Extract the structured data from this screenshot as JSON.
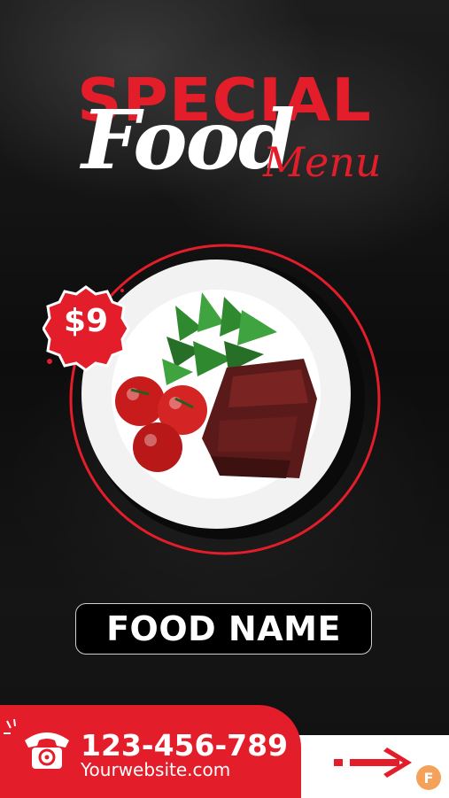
{
  "header": {
    "title_special": "SPECIAL",
    "title_food": "Food",
    "title_menu": "Menu"
  },
  "price": {
    "label": "$9"
  },
  "food": {
    "name": "FOOD NAME"
  },
  "contact": {
    "phone": "123-456-789",
    "website": "Yourwebsite.com"
  },
  "brand": {
    "logo_letter": "F"
  },
  "colors": {
    "accent": "#e31d2a",
    "background": "#0b0b0b",
    "text": "#ffffff",
    "logo": "#f4a259"
  },
  "icons": [
    "phone-icon",
    "arrow-right-icon",
    "brand-logo-icon"
  ]
}
